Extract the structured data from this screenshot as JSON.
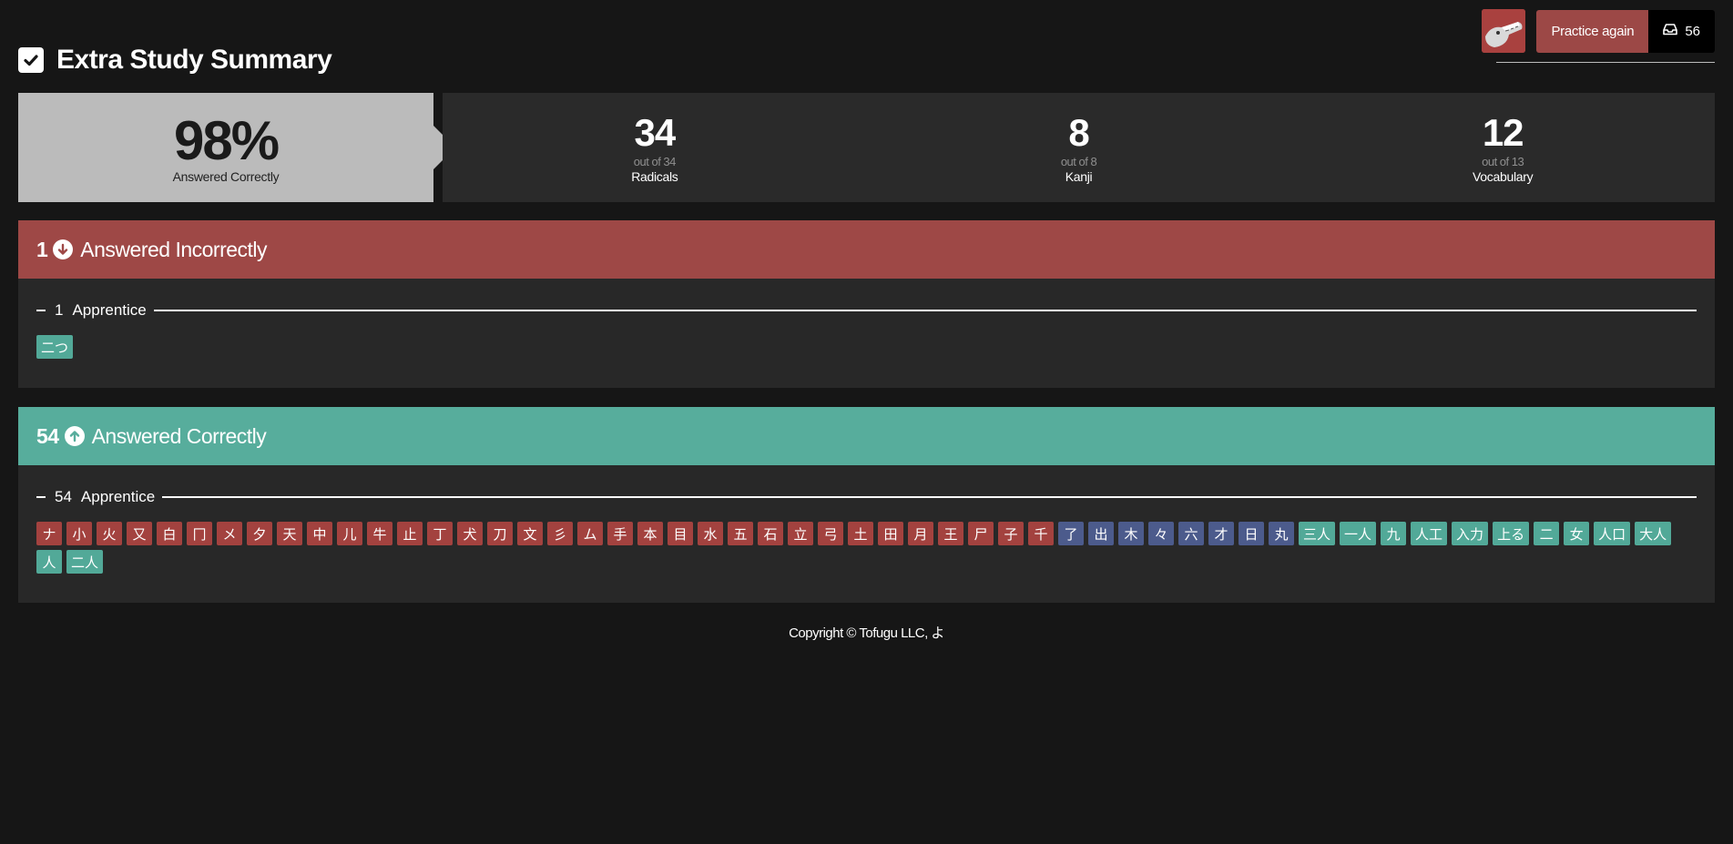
{
  "header": {
    "title": "Extra Study Summary",
    "practice_label": "Practice again",
    "inbox_count": "56"
  },
  "stats": {
    "score": "98%",
    "score_label": "Answered Correctly",
    "radicals": {
      "value": "34",
      "sub": "out of 34",
      "name": "Radicals"
    },
    "kanji": {
      "value": "8",
      "sub": "out of 8",
      "name": "Kanji"
    },
    "vocabulary": {
      "value": "12",
      "sub": "out of 13",
      "name": "Vocabulary"
    }
  },
  "incorrect": {
    "count": "1",
    "label": "Answered Incorrectly",
    "color": "#9e4846",
    "group": {
      "count": "1",
      "name": "Apprentice"
    },
    "items": [
      {
        "text": "二つ",
        "type": "vocabulary"
      }
    ]
  },
  "correct": {
    "count": "54",
    "label": "Answered Correctly",
    "color": "#57ad9c",
    "group": {
      "count": "54",
      "name": "Apprentice"
    },
    "items": [
      {
        "text": "ナ",
        "type": "radical"
      },
      {
        "text": "小",
        "type": "radical"
      },
      {
        "text": "火",
        "type": "radical"
      },
      {
        "text": "又",
        "type": "radical"
      },
      {
        "text": "白",
        "type": "radical"
      },
      {
        "text": "冂",
        "type": "radical"
      },
      {
        "text": "メ",
        "type": "radical"
      },
      {
        "text": "夕",
        "type": "radical"
      },
      {
        "text": "天",
        "type": "radical"
      },
      {
        "text": "中",
        "type": "radical"
      },
      {
        "text": "儿",
        "type": "radical"
      },
      {
        "text": "牛",
        "type": "radical"
      },
      {
        "text": "止",
        "type": "radical"
      },
      {
        "text": "丁",
        "type": "radical"
      },
      {
        "text": "犬",
        "type": "radical"
      },
      {
        "text": "刀",
        "type": "radical"
      },
      {
        "text": "文",
        "type": "radical"
      },
      {
        "text": "彡",
        "type": "radical"
      },
      {
        "text": "ム",
        "type": "radical"
      },
      {
        "text": "手",
        "type": "radical"
      },
      {
        "text": "本",
        "type": "radical"
      },
      {
        "text": "目",
        "type": "radical"
      },
      {
        "text": "水",
        "type": "radical"
      },
      {
        "text": "五",
        "type": "radical"
      },
      {
        "text": "石",
        "type": "radical"
      },
      {
        "text": "立",
        "type": "radical"
      },
      {
        "text": "弓",
        "type": "radical"
      },
      {
        "text": "土",
        "type": "radical"
      },
      {
        "text": "田",
        "type": "radical"
      },
      {
        "text": "月",
        "type": "radical"
      },
      {
        "text": "王",
        "type": "radical"
      },
      {
        "text": "尸",
        "type": "radical"
      },
      {
        "text": "子",
        "type": "radical"
      },
      {
        "text": "千",
        "type": "radical"
      },
      {
        "text": "了",
        "type": "kanji"
      },
      {
        "text": "出",
        "type": "kanji"
      },
      {
        "text": "木",
        "type": "kanji"
      },
      {
        "text": "々",
        "type": "kanji"
      },
      {
        "text": "六",
        "type": "kanji"
      },
      {
        "text": "才",
        "type": "kanji"
      },
      {
        "text": "日",
        "type": "kanji"
      },
      {
        "text": "丸",
        "type": "kanji"
      },
      {
        "text": "三人",
        "type": "vocabulary"
      },
      {
        "text": "一人",
        "type": "vocabulary"
      },
      {
        "text": "九",
        "type": "vocabulary"
      },
      {
        "text": "人工",
        "type": "vocabulary"
      },
      {
        "text": "入力",
        "type": "vocabulary"
      },
      {
        "text": "上る",
        "type": "vocabulary"
      },
      {
        "text": "二",
        "type": "vocabulary"
      },
      {
        "text": "女",
        "type": "vocabulary"
      },
      {
        "text": "人口",
        "type": "vocabulary"
      },
      {
        "text": "大人",
        "type": "vocabulary"
      },
      {
        "text": "人",
        "type": "vocabulary"
      },
      {
        "text": "二人",
        "type": "vocabulary"
      }
    ]
  },
  "colors": {
    "radical": "#a3423f",
    "kanji": "#4c5b8c",
    "vocabulary": "#52a998"
  },
  "footer": {
    "text": "Copyright © Tofugu LLC, よ"
  }
}
